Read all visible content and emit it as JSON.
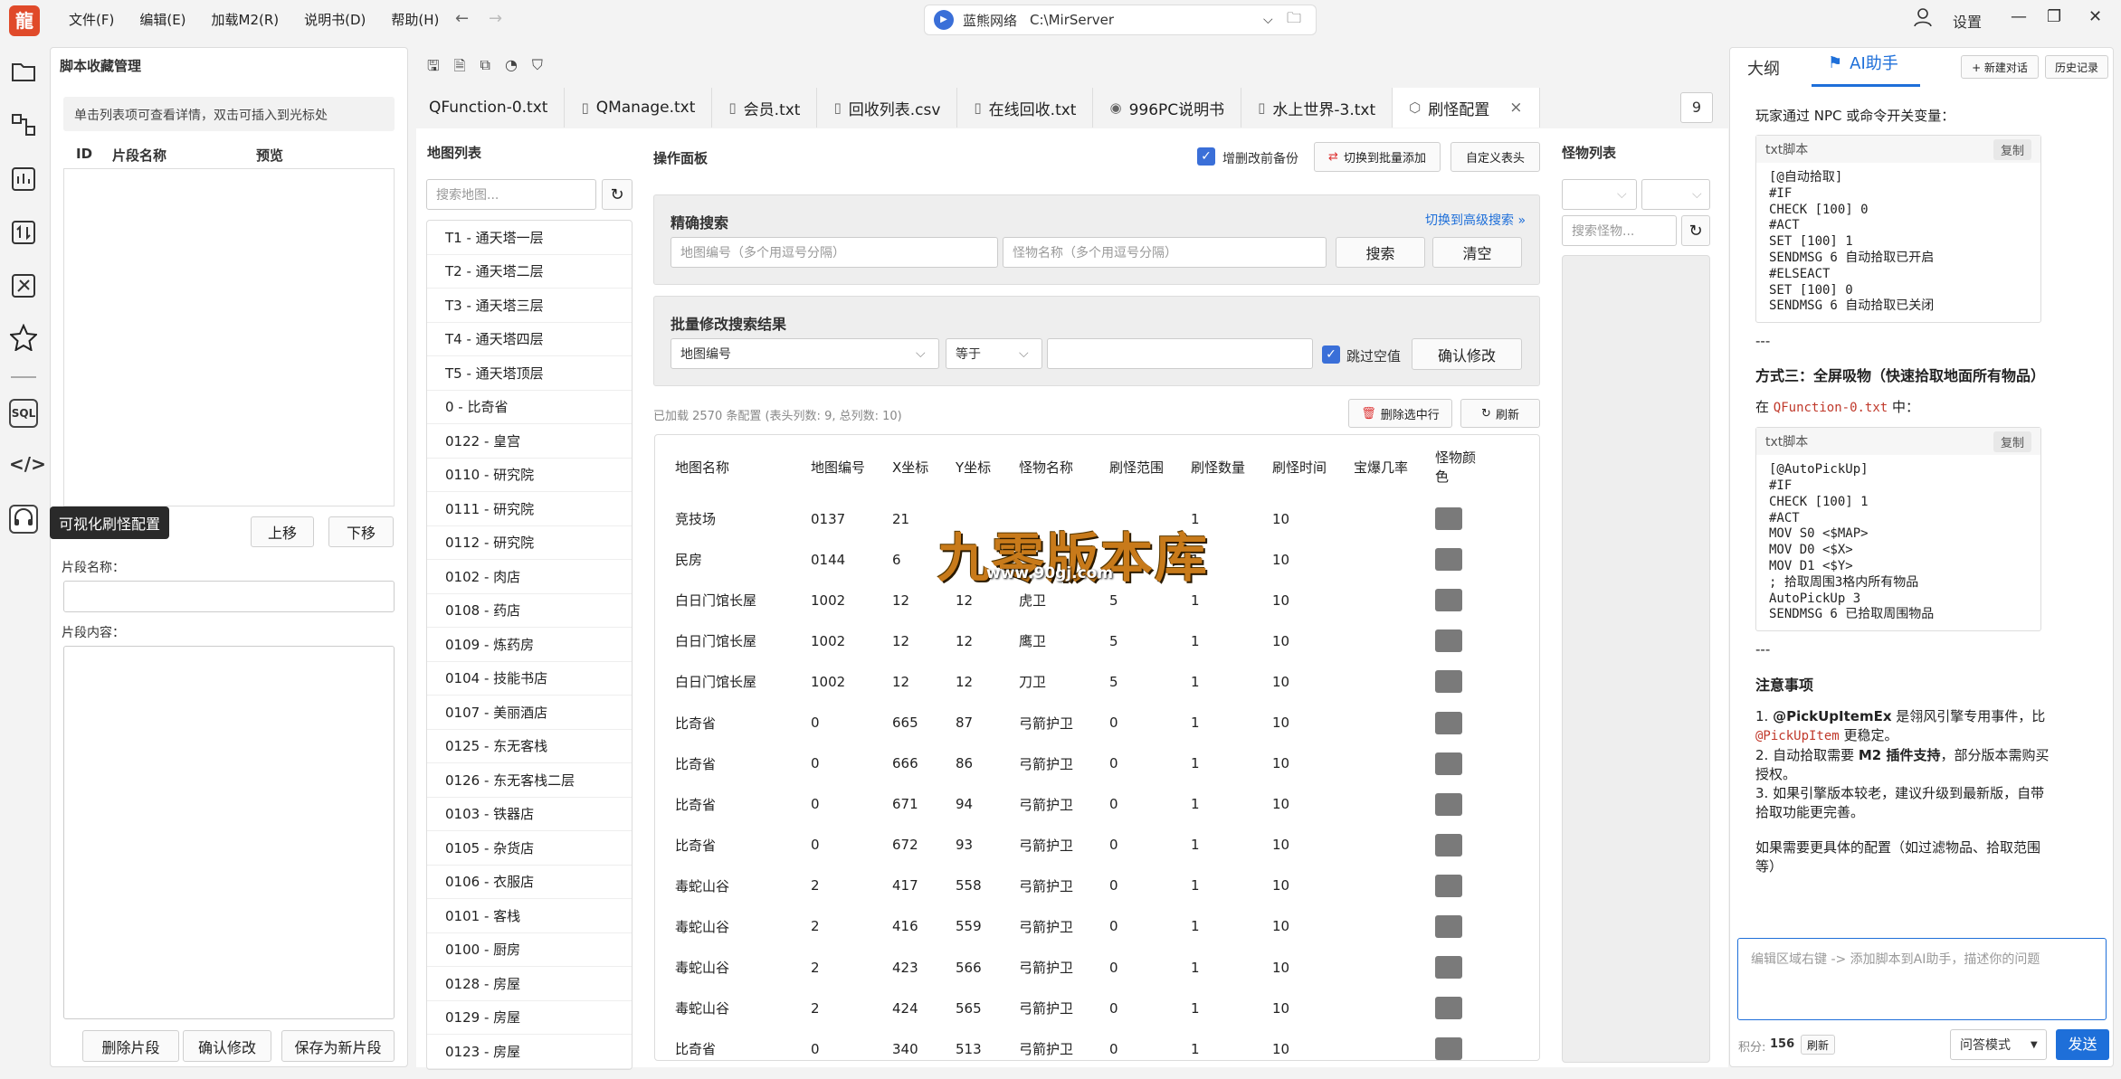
{
  "titlebar": {
    "logo": "龍",
    "menu": [
      "文件(F)",
      "编辑(E)",
      "加载M2(R)",
      "说明书(D)",
      "帮助(H)"
    ],
    "back": "←",
    "forward": "→",
    "server_name": "蓝熊网络",
    "server_path": "C:\\MirServer",
    "user_label": "设置"
  },
  "leftbar": {
    "icons": [
      "folder-icon",
      "nodes-icon",
      "chart-icon",
      "sort-icon",
      "tools-icon",
      "star-icon",
      "sql-icon",
      "code-icon",
      "headset-icon"
    ],
    "sql_label": "SQL",
    "code_label": "</>",
    "tooltip": "可视化刷怪配置"
  },
  "snippets": {
    "title": "脚本收藏管理",
    "hint": "单击列表项可查看详情，双击可插入到光标处",
    "columns": [
      "ID",
      "片段名称",
      "预览"
    ],
    "move_up": "上移",
    "move_down": "下移",
    "name_label": "片段名称：",
    "content_label": "片段内容：",
    "delete_btn": "删除片段",
    "confirm_btn": "确认修改",
    "save_new_btn": "保存为新片段"
  },
  "tabs": {
    "items": [
      {
        "label": "QFunction-0.txt",
        "icon": ""
      },
      {
        "label": "QManage.txt",
        "icon": "▯"
      },
      {
        "label": "会员.txt",
        "icon": "▯"
      },
      {
        "label": "回收列表.csv",
        "icon": "▯"
      },
      {
        "label": "在线回收.txt",
        "icon": "▯"
      },
      {
        "label": "996PC说明书",
        "icon": "◉"
      },
      {
        "label": "水上世界-3.txt",
        "icon": "▯"
      },
      {
        "label": "刷怪配置",
        "icon": "⬡",
        "close": "×"
      }
    ],
    "overflow_count": "9"
  },
  "maplist": {
    "title": "地图列表",
    "search_placeholder": "搜索地图...",
    "items": [
      "T1 - 通天塔一层",
      "T2 - 通天塔二层",
      "T3 - 通天塔三层",
      "T4 - 通天塔四层",
      "T5 - 通天塔顶层",
      "0 - 比奇省",
      "0122 - 皇宫",
      "0110 - 研究院",
      "0111 - 研究院",
      "0112 - 研究院",
      "0102 - 肉店",
      "0108 - 药店",
      "0109 - 炼药房",
      "0104 - 技能书店",
      "0107 - 美丽酒店",
      "0125 - 东无客栈",
      "0126 - 东无客栈二层",
      "0103 - 铁器店",
      "0105 - 杂货店",
      "0106 - 衣服店",
      "0101 - 客栈",
      "0100 - 厨房",
      "0128 - 房屋",
      "0129 - 房屋",
      "0123 - 房屋"
    ]
  },
  "operation": {
    "title": "操作面板",
    "backup_label": "增删改前备份",
    "switch_batch_btn": "切换到批量添加",
    "custom_header_btn": "自定义表头",
    "exact_search_title": "精确搜索",
    "advanced_link": "切换到高级搜索 »",
    "map_id_placeholder": "地图编号（多个用逗号分隔）",
    "monster_placeholder": "怪物名称（多个用逗号分隔）",
    "search_btn": "搜索",
    "clear_btn": "清空",
    "batch_title": "批量修改搜索结果",
    "field_select": "地图编号",
    "op_select": "等于",
    "skip_empty_label": "跳过空值",
    "confirm_modify_btn": "确认修改",
    "status_text": "已加载 2570 条配置 (表头列数: 9, 总列数: 10)",
    "delete_rows_btn": "删除选中行",
    "refresh_btn": "刷新"
  },
  "table": {
    "columns": [
      "地图名称",
      "地图编号",
      "X坐标",
      "Y坐标",
      "怪物名称",
      "刷怪范围",
      "刷怪数量",
      "刷怪时间",
      "宝爆几率",
      "怪物颜色"
    ],
    "rows": [
      [
        "竞技场",
        "0137",
        "21",
        "",
        "",
        "",
        "1",
        "10",
        ""
      ],
      [
        "民房",
        "0144",
        "6",
        "",
        "",
        "",
        "1",
        "10",
        ""
      ],
      [
        "白日门馆长屋",
        "1002",
        "12",
        "12",
        "虎卫",
        "5",
        "1",
        "10",
        ""
      ],
      [
        "白日门馆长屋",
        "1002",
        "12",
        "12",
        "鹰卫",
        "5",
        "1",
        "10",
        ""
      ],
      [
        "白日门馆长屋",
        "1002",
        "12",
        "12",
        "刀卫",
        "5",
        "1",
        "10",
        ""
      ],
      [
        "比奇省",
        "0",
        "665",
        "87",
        "弓箭护卫",
        "0",
        "1",
        "10",
        ""
      ],
      [
        "比奇省",
        "0",
        "666",
        "86",
        "弓箭护卫",
        "0",
        "1",
        "10",
        ""
      ],
      [
        "比奇省",
        "0",
        "671",
        "94",
        "弓箭护卫",
        "0",
        "1",
        "10",
        ""
      ],
      [
        "比奇省",
        "0",
        "672",
        "93",
        "弓箭护卫",
        "0",
        "1",
        "10",
        ""
      ],
      [
        "毒蛇山谷",
        "2",
        "417",
        "558",
        "弓箭护卫",
        "0",
        "1",
        "10",
        ""
      ],
      [
        "毒蛇山谷",
        "2",
        "416",
        "559",
        "弓箭护卫",
        "0",
        "1",
        "10",
        ""
      ],
      [
        "毒蛇山谷",
        "2",
        "423",
        "566",
        "弓箭护卫",
        "0",
        "1",
        "10",
        ""
      ],
      [
        "毒蛇山谷",
        "2",
        "424",
        "565",
        "弓箭护卫",
        "0",
        "1",
        "10",
        ""
      ],
      [
        "比奇省",
        "0",
        "340",
        "513",
        "弓箭护卫",
        "0",
        "1",
        "10",
        ""
      ]
    ]
  },
  "watermark": {
    "title": "九零版本库",
    "url": "www.90gj.com"
  },
  "monsterlist": {
    "title": "怪物列表",
    "search_placeholder": "搜索怪物..."
  },
  "ai": {
    "outline_tab": "大纲",
    "ai_tab": "AI助手",
    "new_chat_btn": "+ 新建对话",
    "history_btn": "历史记录",
    "intro": "玩家通过 NPC 或命令开关变量：",
    "code_lang": "txt脚本",
    "copy": "复制",
    "code1": "[@自动拾取]\n#IF\nCHECK [100] 0\n#ACT\nSET [100] 1\nSENDMSG 6 自动拾取已开启\n#ELSEACT\nSET [100] 0\nSENDMSG 6 自动拾取已关闭",
    "sep": "---",
    "method3": "方式三：全屏吸物（快速拾取地面所有物品）",
    "in_file_prefix": "在 ",
    "in_file_name": "QFunction-0.txt",
    "in_file_suffix": " 中：",
    "code2": "[@AutoPickUp]\n#IF\nCHECK [100] 1\n#ACT\nMOV S0 <$MAP>\nMOV D0 <$X>\nMOV D1 <$Y>\n; 拾取周围3格内所有物品\nAutoPickUp 3\nSENDMSG 6 已拾取周围物品",
    "notes_title": "注意事项",
    "note1_a": "1. ",
    "note1_b": "@PickUpItemEx",
    "note1_c": " 是翎风引擎专用事件，比",
    "note1_d": "@PickUpItem",
    "note1_e": " 更稳定。",
    "note2_a": "2. 自动拾取需要 ",
    "note2_b": "M2 插件支持",
    "note2_c": "，部分版本需购买授权。",
    "note3": "3. 如果引擎版本较老，建议升级到最新版，自带拾取功能更完善。",
    "tail": "如果需要更具体的配置（如过滤物品、拾取范围等）",
    "input_placeholder": "编辑区域右键 -> 添加脚本到AI助手，描述你的问题",
    "points_label": "积分:",
    "points_value": "156",
    "refresh": "刷新",
    "mode": "问答模式",
    "send_btn": "发送"
  },
  "colors": {
    "accent": "#1e6fd9",
    "swatch": "#7a7a7a"
  }
}
